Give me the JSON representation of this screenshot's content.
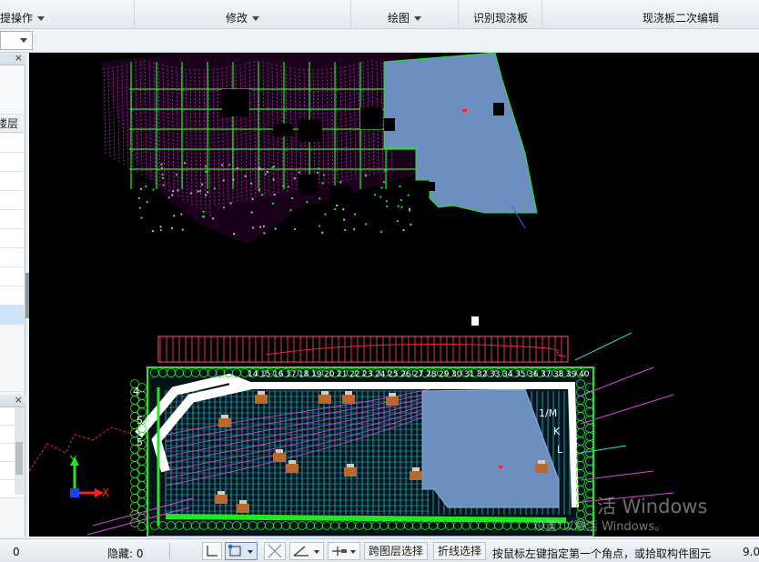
{
  "ribbon": {
    "groups": [
      {
        "label": "提操作",
        "dropdown": true
      },
      {
        "label": "修改",
        "dropdown": true
      },
      {
        "label": "绘图",
        "dropdown": true
      },
      {
        "label": "识别现浇板",
        "dropdown": false
      },
      {
        "label": "现浇板二次编辑",
        "dropdown": false
      }
    ]
  },
  "left_panel": {
    "header_text": "楼层",
    "close_glyph": "×"
  },
  "canvas": {
    "axis_x": "X",
    "axis_y": "Y",
    "labels_top": [
      "14",
      "15",
      "16",
      "17",
      "18",
      "19",
      "20",
      "21",
      "22",
      "23",
      "24",
      "25",
      "26",
      "27",
      "28",
      "29",
      "30",
      "31",
      "32",
      "33",
      "34",
      "35",
      "36",
      "37",
      "38",
      "39",
      "40"
    ],
    "labels_side": [
      "4",
      "5",
      "5",
      "1/M",
      "K",
      "L"
    ],
    "colors": {
      "background": "#000000",
      "slab_fill": "#6d8fbf",
      "grid_green": "#21e821",
      "magenta": "#e040e0",
      "cyan": "#1fe0e0",
      "white": "#ffffff",
      "orange": "#d2691e",
      "red": "#ff2020"
    }
  },
  "watermark": {
    "line1": "活 Windows",
    "line2": "设置\"以激活 Windows。"
  },
  "statusbar": {
    "left_value": "0",
    "hidden_label": "隐藏:",
    "hidden_value": "0",
    "cross_layer_select": "跨图层选择",
    "polyline_select": "折线选择",
    "hint": "按鼠标左键指定第一个角点，或拾取构件图元",
    "right_value": "9.0"
  }
}
